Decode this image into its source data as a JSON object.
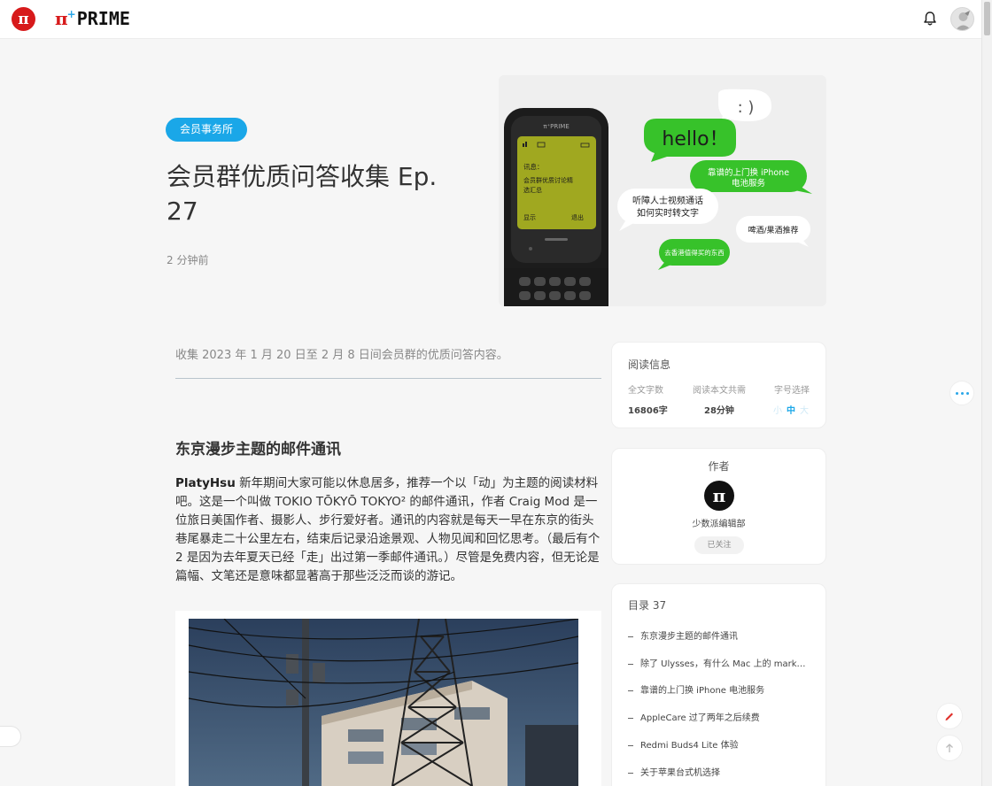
{
  "header": {
    "logo_symbol": "π",
    "prime_symbol": "π",
    "prime_plus": "+",
    "prime_text": "PRIME"
  },
  "hero": {
    "category": "会员事务所",
    "title": "会员群优质问答收集 Ep. 27",
    "time_ago": "2 分钟前",
    "image": {
      "phone_brand": "π⁺PRIME",
      "phone_msg_label": "讯息：",
      "phone_msg_body": "会员群优质讨论精选汇总",
      "phone_left_softkey": "显示",
      "phone_right_softkey": "退出",
      "bubbles": [
        {
          "text": ": )"
        },
        {
          "text": "hello！"
        },
        {
          "text": "靠谱的上门换 iPhone 电池服务"
        },
        {
          "text": "听障人士视频通话如何实时转文字"
        },
        {
          "text": "啤酒/果酒推荐"
        },
        {
          "text": "去香港值得买的东西"
        }
      ],
      "colors": {
        "green": "#37c22a",
        "bg": "#efefef",
        "phone_screen": "#a0a820"
      }
    }
  },
  "article": {
    "lead": "收集 2023 年 1 月 20 日至 2 月 8 日间会员群的优质问答内容。",
    "section_heading": "东京漫步主题的邮件通讯",
    "author_name": "PlatyHsu",
    "body": " 新年期间大家可能以休息居多，推荐一个以「动」为主题的阅读材料吧。这是一个叫做 TOKIO TŌKYŌ TOKYO² 的邮件通讯，作者 Craig Mod 是一位旅日美国作者、摄影人、步行爱好者。通讯的内容就是每天一早在东京的街头巷尾暴走二十公里左右，结束后记录沿途景观、人物见闻和回忆思考。（最后有个 2 是因为去年夏天已经「走」出过第一季邮件通讯。）尽管是免费内容，但无论是篇幅、文笔还是意味都显著高于那些泛泛而谈的游记。"
  },
  "reading_info": {
    "title": "阅读信息",
    "word_count_label": "全文字数",
    "word_count": "16806字",
    "read_time_label": "阅读本文共需",
    "read_time": "28分钟",
    "font_size_label": "字号选择",
    "font_sizes": [
      "小",
      "中",
      "大"
    ],
    "selected_font_size": "中"
  },
  "author_card": {
    "title": "作者",
    "avatar_symbol": "π",
    "name": "少数派编辑部",
    "follow_label": "已关注"
  },
  "toc": {
    "title": "目录 37",
    "items": [
      "东京漫步主题的邮件通讯",
      "除了 Ulysses，有什么 Mac 上的 mark…",
      "靠谱的上门换 iPhone 电池服务",
      "AppleCare 过了两年之后续费",
      "Redmi Buds4 Lite 体验",
      "关于苹果台式机选择"
    ]
  },
  "colors": {
    "accent": "#1aa7e8",
    "brand_red": "#d71a1b"
  }
}
